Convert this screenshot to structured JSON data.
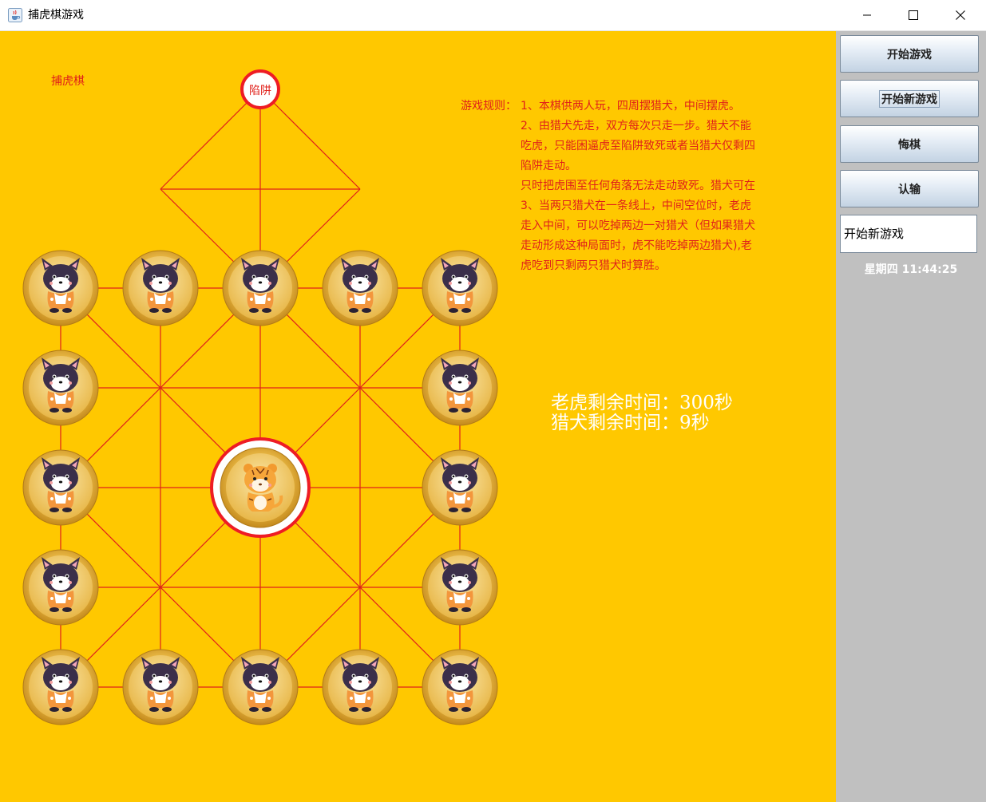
{
  "window": {
    "title": "捕虎棋游戏",
    "icon": "java-cup-icon",
    "controls": [
      "minimize-icon",
      "maximize-icon",
      "close-icon"
    ]
  },
  "board": {
    "label": "捕虎棋",
    "trap_label": "陷阱",
    "background": "#ffc800",
    "line_color": "#e0201a",
    "pieces": {
      "dog_icon": "dog-piece-icon",
      "tiger_icon": "tiger-piece-icon",
      "dog_count": 16,
      "tiger_count": 1
    }
  },
  "rules": {
    "heading": "游戏规则：",
    "lines": [
      "1、本棋供两人玩，四周摆猎犬，中间摆虎。",
      "2、由猎犬先走，双方每次只走一步。猎犬不能",
      "吃虎，只能困逼虎至陷阱致死或者当猎犬仅剩四",
      "陷阱走动。",
      "只时把虎围至任何角落无法走动致死。猎犬可在",
      "3、当两只猎犬在一条线上，中间空位时，老虎",
      "走入中间，可以吃掉两边一对猎犬（但如果猎犬",
      "走动形成这种局面时，虎不能吃掉两边猎犬),老",
      "虎吃到只剩两只猎犬时算胜。"
    ]
  },
  "timers": {
    "tiger": "老虎剩余时间：300秒",
    "dog": "猎犬剩余时间：9秒"
  },
  "side": {
    "buttons": [
      "开始游戏",
      "开始新游戏",
      "悔棋",
      "认输"
    ],
    "status_text": "开始新游戏",
    "clock": "星期四 11:44:25"
  }
}
